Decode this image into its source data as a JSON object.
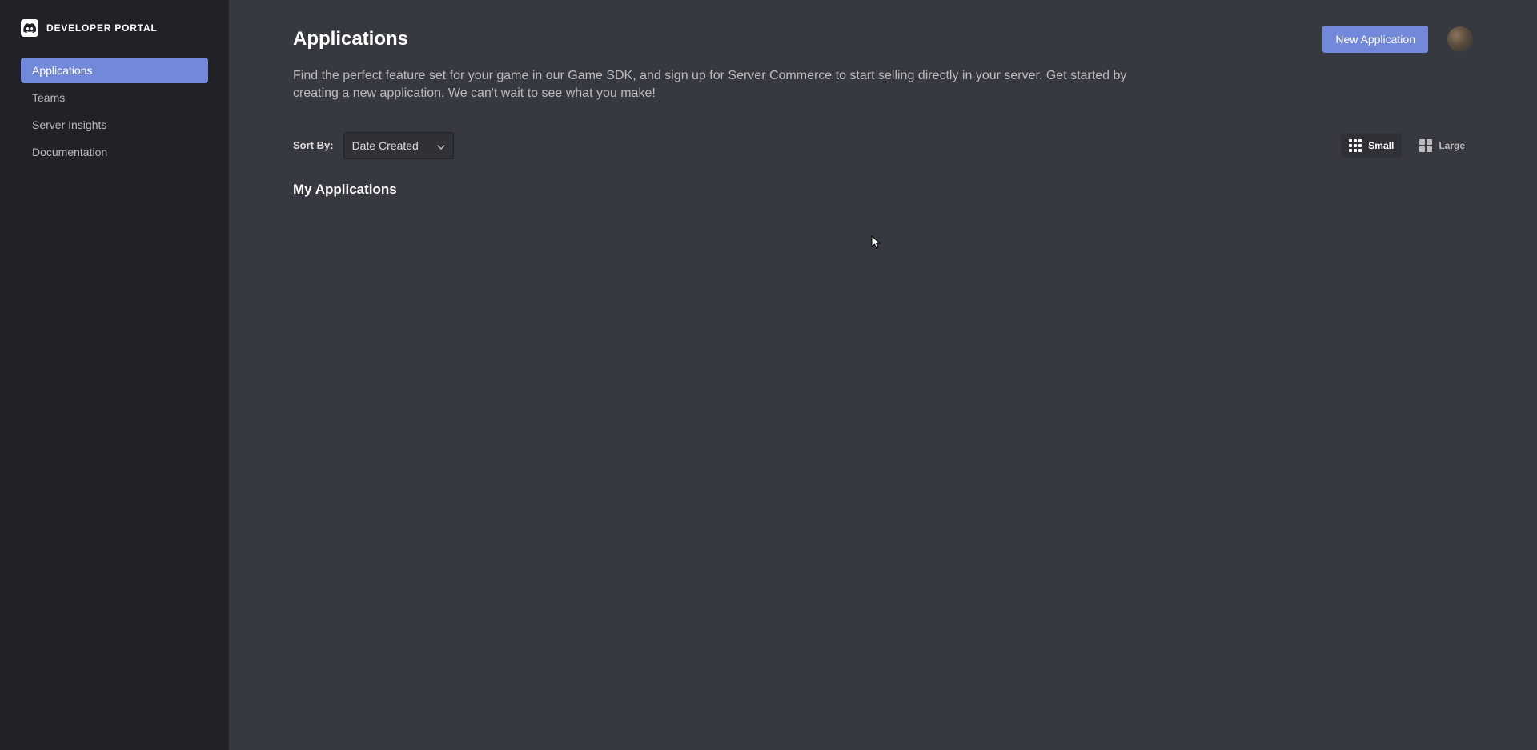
{
  "brand": {
    "portal_name": "DEVELOPER PORTAL"
  },
  "sidebar": {
    "items": [
      {
        "label": "Applications",
        "active": true
      },
      {
        "label": "Teams",
        "active": false
      },
      {
        "label": "Server Insights",
        "active": false
      },
      {
        "label": "Documentation",
        "active": false
      }
    ]
  },
  "header": {
    "title": "Applications",
    "new_button": "New Application"
  },
  "description": "Find the perfect feature set for your game in our Game SDK, and sign up for Server Commerce to start selling directly in your server. Get started by creating a new application. We can't wait to see what you make!",
  "sort": {
    "label": "Sort By:",
    "selected": "Date Created"
  },
  "view": {
    "small": "Small",
    "large": "Large"
  },
  "section": {
    "my_applications": "My Applications"
  }
}
